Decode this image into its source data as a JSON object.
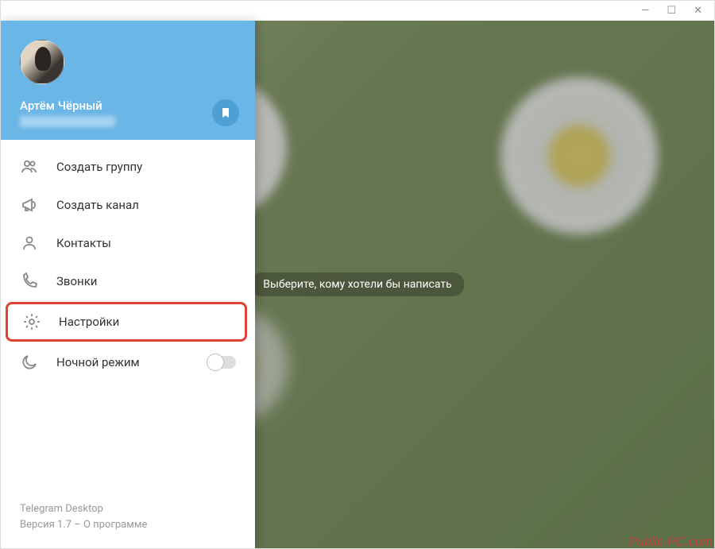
{
  "header": {
    "user_name": "Артём Чёрный"
  },
  "menu": {
    "create_group": "Создать группу",
    "create_channel": "Создать канал",
    "contacts": "Контакты",
    "calls": "Звонки",
    "settings": "Настройки",
    "night_mode": "Ночной режим"
  },
  "footer": {
    "app_name": "Telegram Desktop",
    "version_line": "Версия 1.7 – О программе"
  },
  "main": {
    "placeholder": "Выберите, кому хотели бы написать"
  },
  "watermark": "Public-PC.com"
}
